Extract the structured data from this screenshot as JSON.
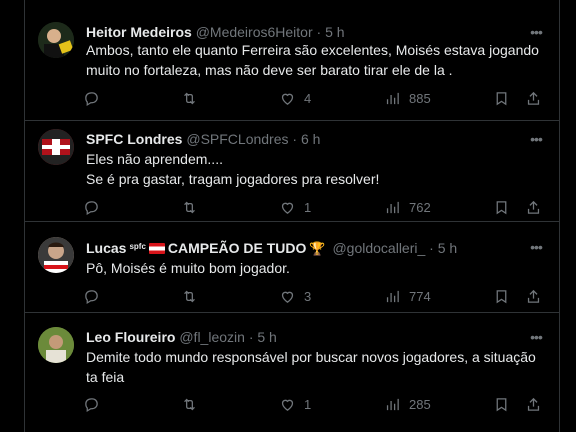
{
  "tweets": [
    {
      "name": "Heitor Medeiros",
      "handle": "@Medeiros6Heitor",
      "separator": "·",
      "time": "5 h",
      "text": "Ambos, tanto ele quanto Ferreira são excelentes, Moisés estava jogando muito no fortaleza, mas não deve ser barato tirar ele de la .",
      "replies": "",
      "retweets": "",
      "likes": "4",
      "views": "885",
      "avatar_color": "#1d2a1a"
    },
    {
      "name": "SPFC Londres",
      "handle": "@SPFCLondres",
      "separator": "·",
      "time": "6 h",
      "text": "Eles não aprendem....\nSe é pra gastar, tragam jogadores pra resolver!",
      "replies": "",
      "retweets": "",
      "likes": "1",
      "views": "762",
      "avatar_color": "#b0121b"
    },
    {
      "name_prefix": "Lucas",
      "name_badge": "spfc",
      "name_suffix": "CAMPEÃO DE TUDO",
      "handle": "@goldocalleri_",
      "separator": "·",
      "time": "5 h",
      "text": "Pô, Moisés é muito bom jogador.",
      "replies": "",
      "retweets": "",
      "likes": "3",
      "views": "774",
      "avatar_color": "#c9a58a"
    },
    {
      "name": "Leo Floureiro",
      "handle": "@fl_leozin",
      "separator": "·",
      "time": "5 h",
      "text": "Demite todo mundo responsável por buscar novos jogadores, a situação ta feia",
      "replies": "",
      "retweets": "",
      "likes": "1",
      "views": "285",
      "avatar_color": "#6b8a3a"
    }
  ],
  "colors": {
    "background": "#000000",
    "text": "#e7e9ea",
    "muted": "#71767b",
    "border": "#2f3336"
  }
}
